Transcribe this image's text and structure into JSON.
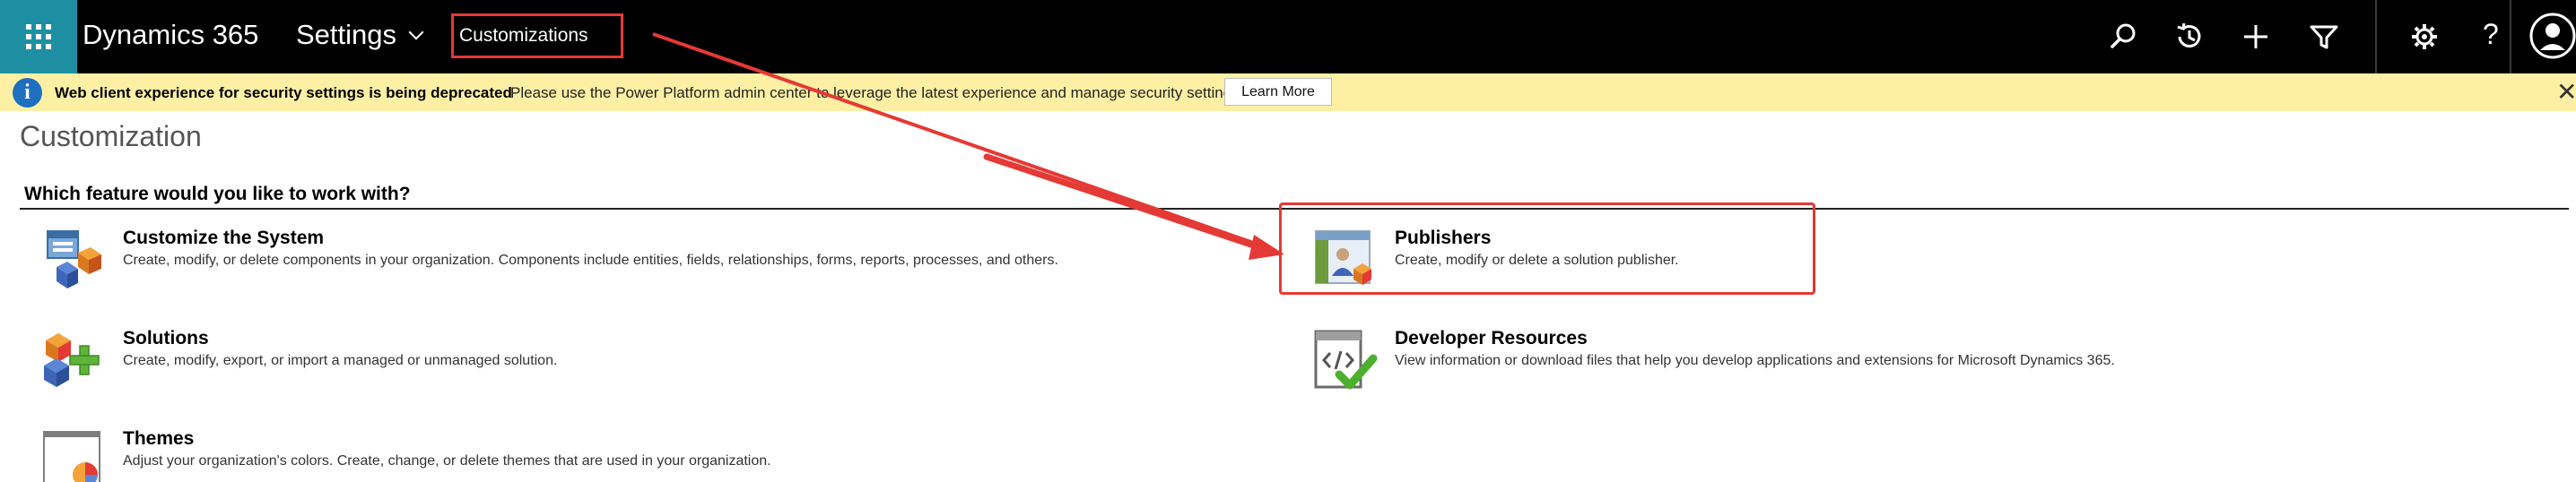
{
  "topbar": {
    "app_title": "Dynamics 365",
    "area_title": "Settings",
    "breadcrumb": "Customizations",
    "icons": [
      "search-icon",
      "recent-icon",
      "plus-icon",
      "filter-icon",
      "gear-icon",
      "help-icon",
      "avatar"
    ],
    "help_label": "?"
  },
  "notification": {
    "bold_text": "Web client experience for security settings is being deprecated",
    "text": "Please use the Power Platform admin center to leverage the latest experience and manage security settings",
    "button_label": "Learn More",
    "close_label": "✕"
  },
  "main": {
    "page_title": "Customization",
    "section_heading": "Which feature would you like to work with?",
    "features": [
      {
        "title": "Customize the System",
        "description": "Create, modify, or delete components in your organization. Components include entities, fields, relationships, forms, reports, processes, and others.",
        "icon": "customize-system-icon"
      },
      {
        "title": "Publishers",
        "description": "Create, modify or delete a solution publisher.",
        "icon": "publishers-icon"
      },
      {
        "title": "Solutions",
        "description": "Create, modify, export, or import a managed or unmanaged solution.",
        "icon": "solutions-icon"
      },
      {
        "title": "Developer Resources",
        "description": "View information or download files that help you develop applications and extensions for Microsoft Dynamics 365.",
        "icon": "developer-resources-icon"
      },
      {
        "title": "Themes",
        "description": "Adjust your organization's colors. Create, change, or delete themes that are used in your organization.",
        "icon": "themes-icon"
      }
    ]
  },
  "colors": {
    "topbar": "#000000",
    "waffle": "#1e8fa3",
    "notification": "#fdf0a5",
    "annotation": "#e53935"
  }
}
